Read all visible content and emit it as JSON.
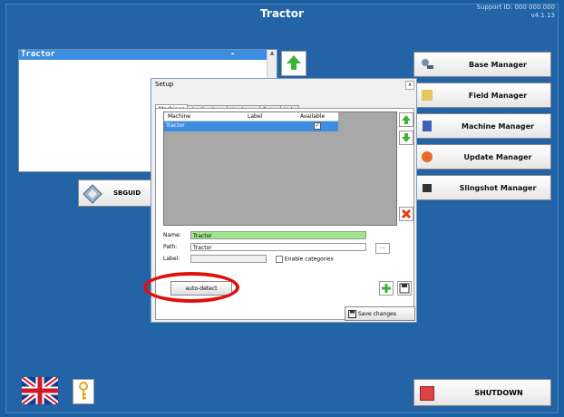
{
  "app": {
    "title": "Tractor",
    "support_line1": "Support ID: 000 000 000",
    "version": "v4.1.13"
  },
  "list": {
    "selected_item": "Tractor",
    "selected_marker": "-"
  },
  "left_button": {
    "label": "SBGUID"
  },
  "managers": [
    {
      "label": "Base Manager",
      "icon": "satellite-icon"
    },
    {
      "label": "Field Manager",
      "icon": "field-icon"
    },
    {
      "label": "Machine Manager",
      "icon": "machine-icon"
    },
    {
      "label": "Update Manager",
      "icon": "update-icon"
    },
    {
      "label": "Slingshot Manager",
      "icon": "slingshot-icon"
    }
  ],
  "dialog": {
    "title": "Setup",
    "close": "x",
    "tabs": [
      "Machines",
      "Applications",
      "Hardware",
      "Extra",
      "Help"
    ],
    "active_tab": "Machines",
    "grid": {
      "headers": [
        "Machine",
        "Label",
        "Available"
      ],
      "rows": [
        {
          "machine": "Tractor",
          "label": "",
          "available": "✓"
        }
      ]
    },
    "fields": {
      "name_label": "Name:",
      "name_value": "Tractor",
      "path_label": "Path:",
      "path_value": "Tractor",
      "label_label": "Label:",
      "label_value": "",
      "enable_categories": "Enable categories"
    },
    "browse": "...",
    "auto_detect": "auto-detect",
    "save_changes": "Save changes"
  },
  "shutdown": {
    "label": "SHUTDOWN"
  },
  "colors": {
    "background": "#1a5fa0",
    "selection": "#3d8de0",
    "highlight_field": "#9fe88a",
    "annotation_ring": "#e01010"
  }
}
